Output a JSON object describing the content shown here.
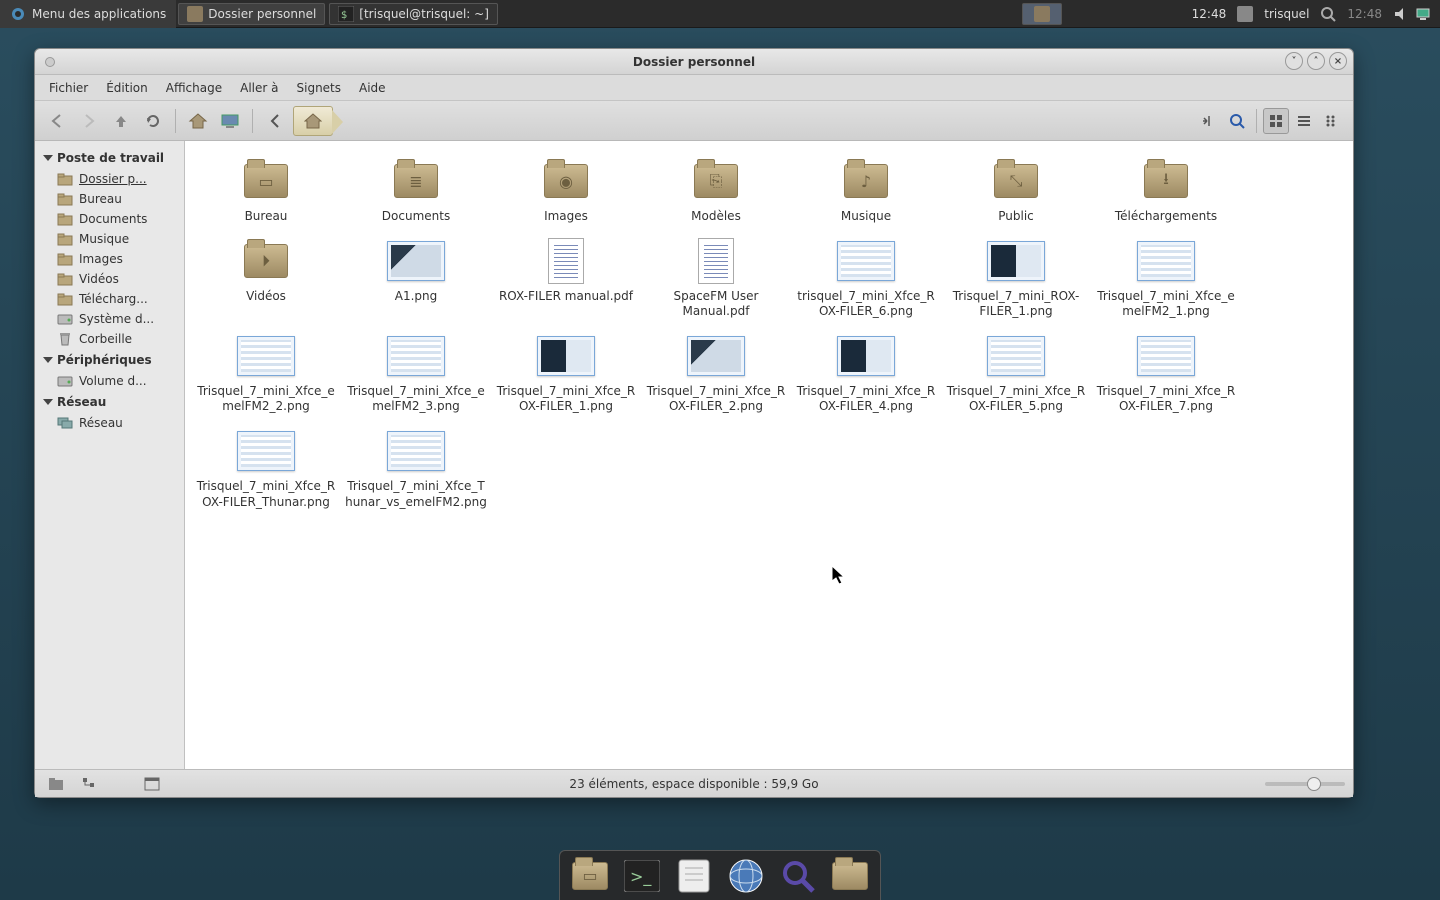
{
  "panel": {
    "app_menu": "Menu des applications",
    "tasks": [
      {
        "label": "Dossier personnel"
      },
      {
        "label": "[trisquel@trisquel: ~]"
      }
    ],
    "clock": "12:48",
    "user": "trisquel",
    "clock2": "12:48"
  },
  "window": {
    "title": "Dossier personnel",
    "menu": [
      "Fichier",
      "Édition",
      "Affichage",
      "Aller à",
      "Signets",
      "Aide"
    ],
    "status": "23 éléments, espace disponible : 59,9 Go"
  },
  "sidebar": {
    "section_devices_title": "Poste de travail",
    "items": [
      {
        "label": "Dossier p...",
        "type": "folder",
        "selected": true
      },
      {
        "label": "Bureau",
        "type": "folder"
      },
      {
        "label": "Documents",
        "type": "folder"
      },
      {
        "label": "Musique",
        "type": "folder"
      },
      {
        "label": "Images",
        "type": "folder"
      },
      {
        "label": "Vidéos",
        "type": "folder"
      },
      {
        "label": "Télécharg...",
        "type": "folder"
      },
      {
        "label": "Système d...",
        "type": "disk"
      },
      {
        "label": "Corbeille",
        "type": "trash"
      }
    ],
    "section_periph_title": "Périphériques",
    "periph": [
      {
        "label": "Volume d...",
        "type": "disk"
      }
    ],
    "section_network_title": "Réseau",
    "network": [
      {
        "label": "Réseau",
        "type": "net"
      }
    ]
  },
  "files": [
    {
      "name": "Bureau",
      "kind": "folder",
      "glyph": "▭"
    },
    {
      "name": "Documents",
      "kind": "folder",
      "glyph": "≣"
    },
    {
      "name": "Images",
      "kind": "folder",
      "glyph": "◉"
    },
    {
      "name": "Modèles",
      "kind": "folder",
      "glyph": "⎘"
    },
    {
      "name": "Musique",
      "kind": "folder",
      "glyph": "♪"
    },
    {
      "name": "Public",
      "kind": "folder",
      "glyph": "⤡"
    },
    {
      "name": "Téléchargements",
      "kind": "folder",
      "glyph": "⭳"
    },
    {
      "name": "Vidéos",
      "kind": "folder",
      "glyph": "⏵"
    },
    {
      "name": "A1.png",
      "kind": "thumb",
      "style": "mix"
    },
    {
      "name": "ROX-FILER manual.pdf",
      "kind": "doc"
    },
    {
      "name": "SpaceFM User Manual.pdf",
      "kind": "doc"
    },
    {
      "name": "trisquel_7_mini_Xfce_ROX-FILER_6.png",
      "kind": "thumb",
      "style": "light"
    },
    {
      "name": "Trisquel_7_mini_ROX-FILER_1.png",
      "kind": "thumb",
      "style": "dark"
    },
    {
      "name": "Trisquel_7_mini_Xfce_emelFM2_1.png",
      "kind": "thumb",
      "style": "light"
    },
    {
      "name": "Trisquel_7_mini_Xfce_emelFM2_2.png",
      "kind": "thumb",
      "style": "light"
    },
    {
      "name": "Trisquel_7_mini_Xfce_emelFM2_3.png",
      "kind": "thumb",
      "style": "light"
    },
    {
      "name": "Trisquel_7_mini_Xfce_ROX-FILER_1.png",
      "kind": "thumb",
      "style": "dark"
    },
    {
      "name": "Trisquel_7_mini_Xfce_ROX-FILER_2.png",
      "kind": "thumb",
      "style": "mix"
    },
    {
      "name": "Trisquel_7_mini_Xfce_ROX-FILER_4.png",
      "kind": "thumb",
      "style": "dark"
    },
    {
      "name": "Trisquel_7_mini_Xfce_ROX-FILER_5.png",
      "kind": "thumb",
      "style": "light"
    },
    {
      "name": "Trisquel_7_mini_Xfce_ROX-FILER_7.png",
      "kind": "thumb",
      "style": "light"
    },
    {
      "name": "Trisquel_7_mini_Xfce_ROX-FILER_Thunar.png",
      "kind": "thumb",
      "style": "light"
    },
    {
      "name": "Trisquel_7_mini_Xfce_Thunar_vs_emelFM2.png",
      "kind": "thumb",
      "style": "light"
    }
  ]
}
